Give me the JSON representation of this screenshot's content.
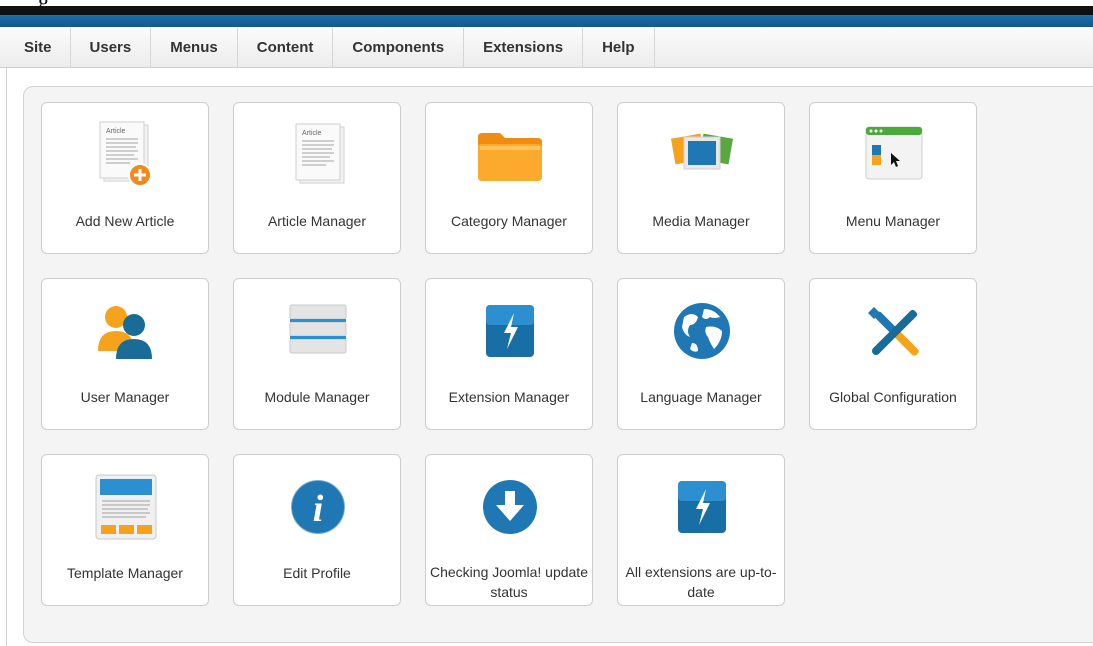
{
  "menu": {
    "items": [
      {
        "label": "Site"
      },
      {
        "label": "Users"
      },
      {
        "label": "Menus"
      },
      {
        "label": "Content"
      },
      {
        "label": "Components"
      },
      {
        "label": "Extensions"
      },
      {
        "label": "Help"
      }
    ]
  },
  "tiles": [
    {
      "label": "Add New Article",
      "icon": "add-article-icon"
    },
    {
      "label": "Article Manager",
      "icon": "article-icon"
    },
    {
      "label": "Category Manager",
      "icon": "folder-icon"
    },
    {
      "label": "Media Manager",
      "icon": "media-icon"
    },
    {
      "label": "Menu Manager",
      "icon": "menu-window-icon"
    },
    {
      "label": "User Manager",
      "icon": "users-icon"
    },
    {
      "label": "Module Manager",
      "icon": "modules-icon"
    },
    {
      "label": "Extension Manager",
      "icon": "lightning-icon"
    },
    {
      "label": "Language Manager",
      "icon": "globe-icon"
    },
    {
      "label": "Global Configuration",
      "icon": "tools-icon"
    },
    {
      "label": "Template Manager",
      "icon": "template-icon"
    },
    {
      "label": "Edit Profile",
      "icon": "info-icon"
    },
    {
      "label": "Checking Joomla! update status",
      "icon": "download-icon"
    },
    {
      "label": "All extensions are up-to-date",
      "icon": "lightning-icon"
    }
  ],
  "icon_text": {
    "article_heading": "Article"
  },
  "colors": {
    "accent_blue": "#1d6fa8",
    "folder_orange": "#f5a21c",
    "add_badge": "#f08a1c",
    "icon_blue": "#1f78b4"
  }
}
